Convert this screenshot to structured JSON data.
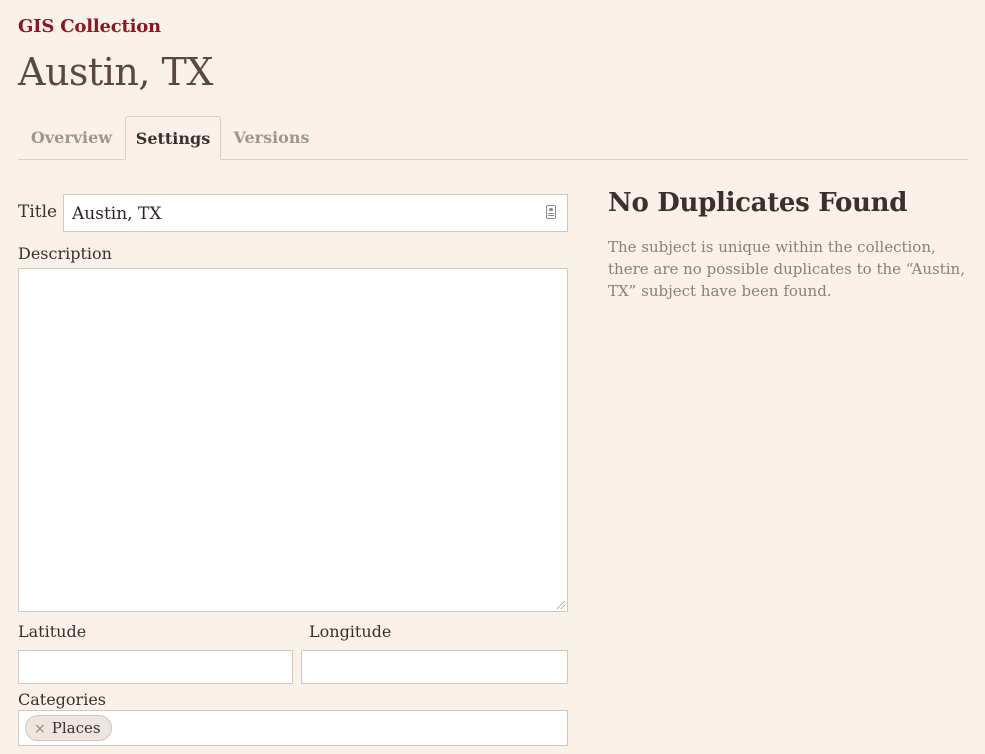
{
  "header": {
    "collection_link": "GIS Collection",
    "page_title": "Austin, TX"
  },
  "tabs": [
    {
      "label": "Overview",
      "active": false
    },
    {
      "label": "Settings",
      "active": true
    },
    {
      "label": "Versions",
      "active": false
    }
  ],
  "form": {
    "title_label": "Title",
    "title_value": "Austin, TX",
    "description_label": "Description",
    "description_value": "",
    "latitude_label": "Latitude",
    "latitude_value": "",
    "longitude_label": "Longitude",
    "longitude_value": "",
    "categories_label": "Categories",
    "categories": [
      {
        "label": "Places",
        "remove_glyph": "×"
      }
    ]
  },
  "duplicates": {
    "heading": "No Duplicates Found",
    "message": "The subject is unique within the collection, there are no possible duplicates to the “Austin, TX” subject have been found."
  },
  "colors": {
    "background": "#faf2e8",
    "accent": "#8e1523",
    "text": "#3b2f2f",
    "muted": "#8b7f78"
  },
  "icons": {
    "title_input_icon": "contact-card-icon",
    "chip_remove_icon": "close-icon"
  }
}
